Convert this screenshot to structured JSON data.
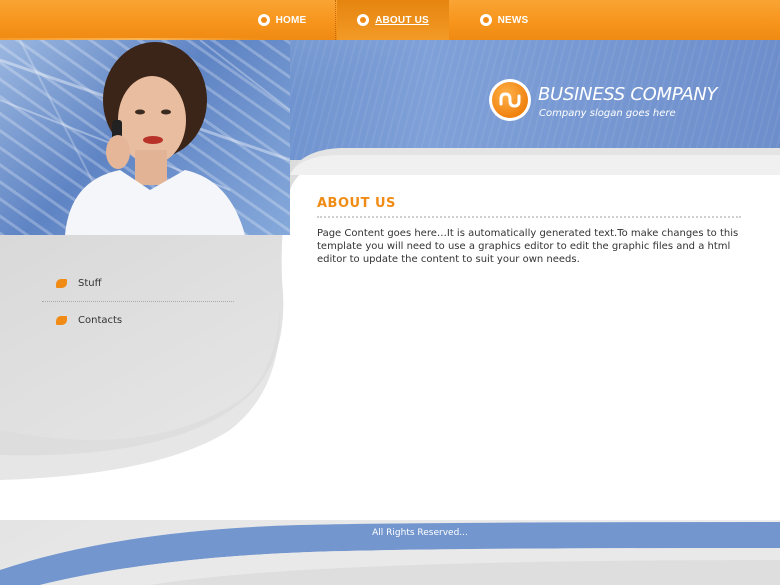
{
  "nav": {
    "items": [
      {
        "label": "HOME",
        "active": false
      },
      {
        "label": "ABOUT US",
        "active": true
      },
      {
        "label": "NEWS",
        "active": false
      }
    ]
  },
  "brand": {
    "name": "BUSINESS COMPANY",
    "slogan": "Company slogan goes here",
    "logo_icon": "wave-icon",
    "accent_color": "#f08c16",
    "header_blue": "#6a8fcc"
  },
  "content": {
    "title": "ABOUT US",
    "body": "Page Content goes here…It is automatically generated text.To make changes to this template you will need to use a graphics editor to edit the graphic files and a html editor to update the content to suit your own needs."
  },
  "sidebar": {
    "items": [
      {
        "label": "Stuff"
      },
      {
        "label": "Contacts"
      }
    ]
  },
  "footer": {
    "text": "All Rights Reserved..."
  }
}
